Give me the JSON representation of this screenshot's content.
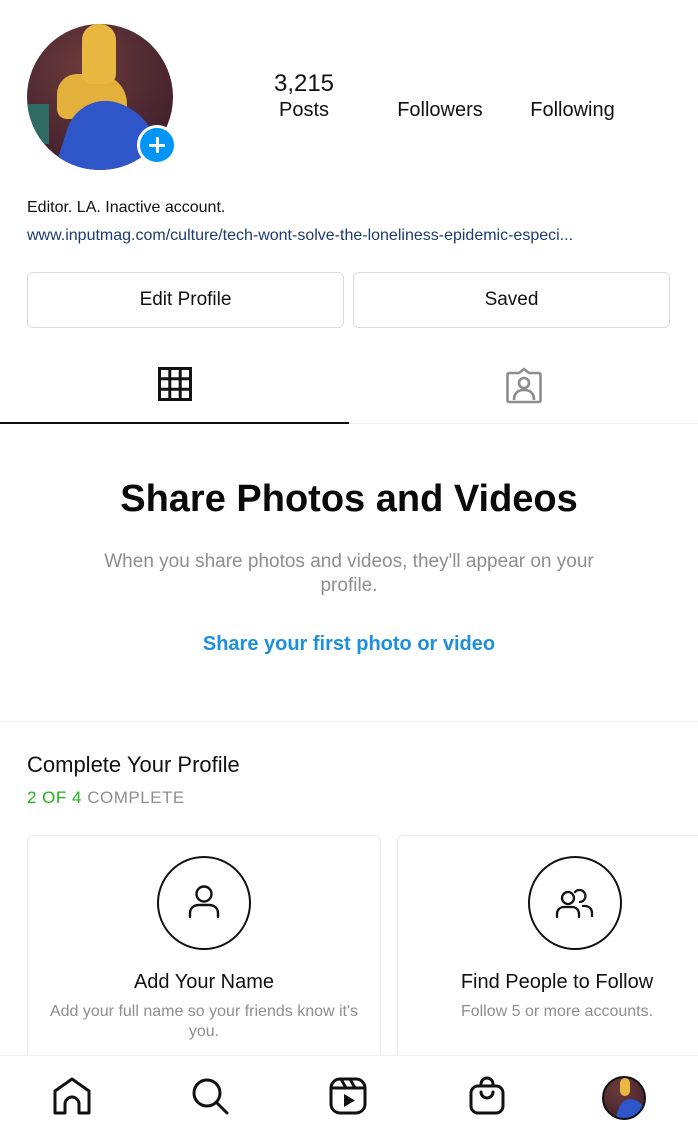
{
  "profile": {
    "avatar_alt": "Profile picture",
    "add_story_icon": "plus-icon",
    "stats": {
      "posts_count": "3,215",
      "posts_label": "Posts",
      "followers_label": "Followers",
      "following_label": "Following"
    },
    "bio": "Editor. LA. Inactive account.",
    "link": "www.inputmag.com/culture/tech-wont-solve-the-loneliness-epidemic-especi..."
  },
  "actions": {
    "edit_profile_label": "Edit Profile",
    "saved_label": "Saved"
  },
  "tabs": [
    {
      "name": "grid",
      "icon": "grid-icon",
      "active": true
    },
    {
      "name": "tagged",
      "icon": "tagged-person-icon",
      "active": false
    }
  ],
  "empty_state": {
    "title": "Share Photos and Videos",
    "description": "When you share photos and videos, they'll appear on your profile.",
    "link": "Share your first photo or video"
  },
  "complete_profile": {
    "title": "Complete Your Profile",
    "progress_done": "2 OF 4",
    "progress_rest": " COMPLETE",
    "cards": [
      {
        "icon": "person-icon",
        "title": "Add Your Name",
        "description": "Add your full name so your friends know it's you."
      },
      {
        "icon": "people-icon",
        "title": "Find People to Follow",
        "description": "Follow 5 or more accounts."
      }
    ]
  },
  "bottom_nav": [
    {
      "name": "home",
      "icon": "home-icon"
    },
    {
      "name": "search",
      "icon": "search-icon"
    },
    {
      "name": "reels",
      "icon": "reels-icon"
    },
    {
      "name": "shop",
      "icon": "shop-bag-icon"
    },
    {
      "name": "profile",
      "icon": "profile-avatar"
    }
  ],
  "colors": {
    "accent_blue": "#0095f6",
    "link_blue": "#1d8fdf",
    "progress_green": "#20b21a",
    "muted_gray": "#8e8e8e"
  }
}
